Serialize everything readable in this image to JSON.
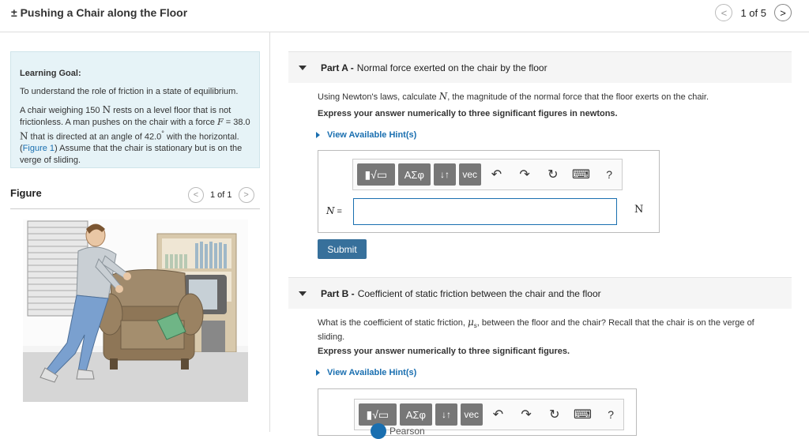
{
  "header": {
    "title": "± Pushing a Chair along the Floor",
    "pager_text": "1 of 5",
    "prev_glyph": "<",
    "next_glyph": ">"
  },
  "goal": {
    "heading": "Learning Goal:",
    "intro": "To understand the role of friction in a state of equilibrium.",
    "text_a": "A chair weighing 150 ",
    "unit_n1": "N",
    "text_b": " rests on a level floor that is not frictionless. A man pushes on the chair with a force ",
    "force_var": "F",
    "text_c": " = 38.0 ",
    "unit_n2": "N",
    "text_d": " that is directed at an angle of 42.0",
    "degree": "°",
    "text_e": " with the horizontal.(",
    "fig_link": "Figure 1",
    "text_f": ") Assume that the chair is stationary but is on the verge of sliding."
  },
  "figure": {
    "heading": "Figure",
    "pager_text": "1 of 1",
    "prev_glyph": "<",
    "next_glyph": ">"
  },
  "partA": {
    "label": "Part A -",
    "title": "Normal force exerted on the chair by the floor",
    "question_a": "Using Newton's laws, calculate ",
    "question_var": "N",
    "question_b": ", the magnitude of the normal force that the floor exerts on the chair.",
    "instruction": "Express your answer numerically to three significant figures in newtons.",
    "hint": "View Available Hint(s)",
    "eq_var": "N",
    "eq_sign": " =",
    "unit": "N",
    "submit": "Submit"
  },
  "partB": {
    "label": "Part B -",
    "title": "Coefficient of static friction between the chair and the floor",
    "question_a": "What is the coefficient of static friction, ",
    "question_var": "μ",
    "question_sub": "s",
    "question_b": ", between the floor and the chair? Recall that the chair is on the verge of sliding.",
    "instruction": "Express your answer numerically to three significant figures.",
    "hint": "View Available Hint(s)"
  },
  "toolbar": {
    "templates": "▮√▭",
    "symbols": "ΑΣφ",
    "updown": "↓↑",
    "vec": "vec",
    "undo": "↶",
    "redo": "↷",
    "reset": "↻",
    "keyboard": "⌨",
    "help": "?"
  },
  "footer": {
    "brand": "Pearson"
  },
  "colors": {
    "link": "#1a6fb0",
    "submit": "#37709b",
    "goal_bg": "#e6f3f7"
  }
}
